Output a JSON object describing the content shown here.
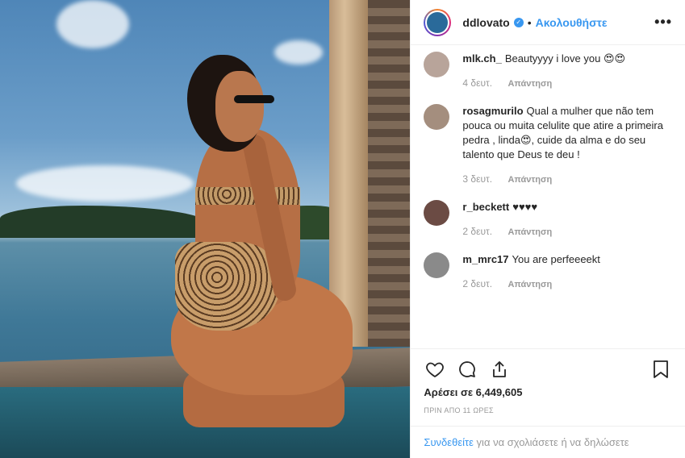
{
  "post": {
    "photo_alt": "",
    "header": {
      "username": "ddlovato",
      "verified_icon": "verified-badge-icon",
      "follow_label": "Ακολουθήστε",
      "more_icon": "more-options-icon",
      "avatar_color": "#2a6a9a"
    },
    "comments": [
      {
        "user": "mlk.ch_",
        "text": "Beautyyyy i love you 😍😍",
        "time": "4 δευτ.",
        "reply": "Απάντηση",
        "avatar_color": "#b8a49a"
      },
      {
        "user": "rosagmurilo",
        "text": "Qual a mulher que não tem pouca ou muita celulite que atire a primeira pedra , linda😍, cuide da alma e do seu talento que Deus te deu !",
        "time": "3 δευτ.",
        "reply": "Απάντηση",
        "avatar_color": "#a48e7e"
      },
      {
        "user": "r_beckett",
        "text": "♥♥♥♥",
        "time": "2 δευτ.",
        "reply": "Απάντηση",
        "avatar_color": "#6b4b44"
      },
      {
        "user": "m_mrc17",
        "text": "You are perfeeeekt",
        "time": "2 δευτ.",
        "reply": "Απάντηση",
        "avatar_color": "#8a8a8a"
      }
    ],
    "actions": {
      "like_icon": "heart-icon",
      "comment_icon": "comment-icon",
      "share_icon": "share-icon",
      "save_icon": "bookmark-icon"
    },
    "likes": "Αρέσει σε 6,449,605",
    "timestamp": "ΠΡΙΝ ΑΠΟ 11 ΩΡΕΣ",
    "login": {
      "link": "Συνδεθείτε",
      "text": " για να σχολιάσετε ή να δηλώσετε"
    }
  }
}
